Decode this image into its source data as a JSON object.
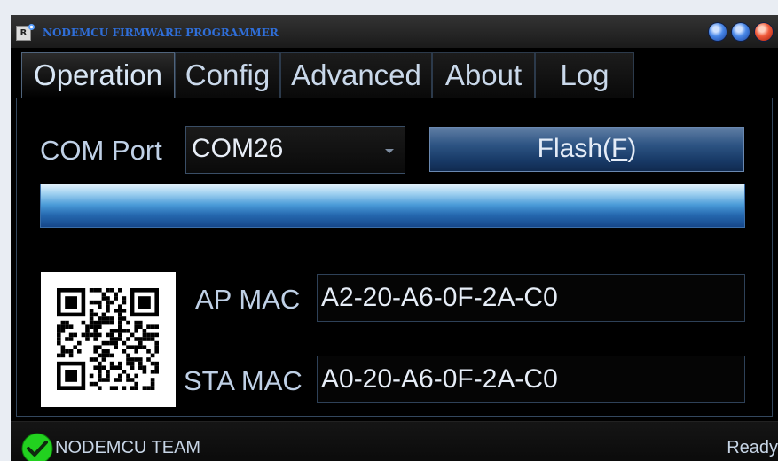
{
  "window": {
    "title": "NODEMCU FIRMWARE PROGRAMMER",
    "app_icon_text": "R"
  },
  "tabs": [
    {
      "label": "Operation",
      "active": true
    },
    {
      "label": "Config",
      "active": false
    },
    {
      "label": "Advanced",
      "active": false
    },
    {
      "label": "About",
      "active": false
    },
    {
      "label": "Log",
      "active": false
    }
  ],
  "operation": {
    "com_port_label": "COM Port",
    "com_port_value": "COM26",
    "flash_button": {
      "before": "Flash(",
      "accel": "F",
      "after": ")"
    },
    "progress_fraction": 1.0,
    "ap_mac_label": "AP MAC",
    "ap_mac_value": "A2-20-A6-0F-2A-C0",
    "sta_mac_label": "STA MAC",
    "sta_mac_value": "A0-20-A6-0F-2A-C0"
  },
  "status": {
    "left": "NODEMCU TEAM",
    "right": "Ready"
  },
  "colors": {
    "accent": "#2f6ed8",
    "status_ok": "#22d11f",
    "background": "#000000"
  },
  "icons": [
    "app-icon",
    "window-minimize-icon",
    "window-maximize-icon",
    "window-close-icon",
    "dropdown-arrow-icon",
    "qr-code-icon",
    "status-ok-icon"
  ]
}
